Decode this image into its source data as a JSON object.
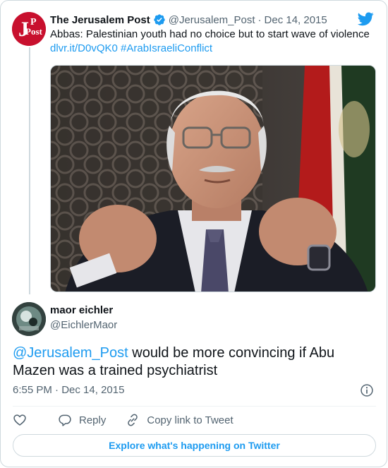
{
  "parent_tweet": {
    "author_name": "The Jerusalem Post",
    "author_handle": "@Jerusalem_Post",
    "separator": "·",
    "date": "Dec 14, 2015",
    "avatar_text": "JPost",
    "text": "Abbas: Palestinian youth had no choice but to start wave of violence",
    "link": "dlvr.it/D0vQK0",
    "hashtag": "#ArabIsraeliConflict"
  },
  "reply_tweet": {
    "author_name": "maor eichler",
    "author_handle": "@EichlerMaor",
    "mention": "@Jerusalem_Post",
    "text": " would be more convincing if Abu Mazen was a trained psychiatrist",
    "time": "6:55 PM",
    "separator": "·",
    "date": "Dec 14, 2015"
  },
  "actions": {
    "reply_label": "Reply",
    "copy_link_label": "Copy link to Tweet"
  },
  "explore_label": "Explore what's happening on Twitter",
  "colors": {
    "accent": "#1d9bf0",
    "secondary_text": "#536471",
    "border": "#cfd9de",
    "jpost_brand": "#c8102e"
  },
  "icons": [
    "verified-badge-icon",
    "twitter-bird-icon",
    "info-icon",
    "heart-icon",
    "reply-icon",
    "link-icon"
  ]
}
